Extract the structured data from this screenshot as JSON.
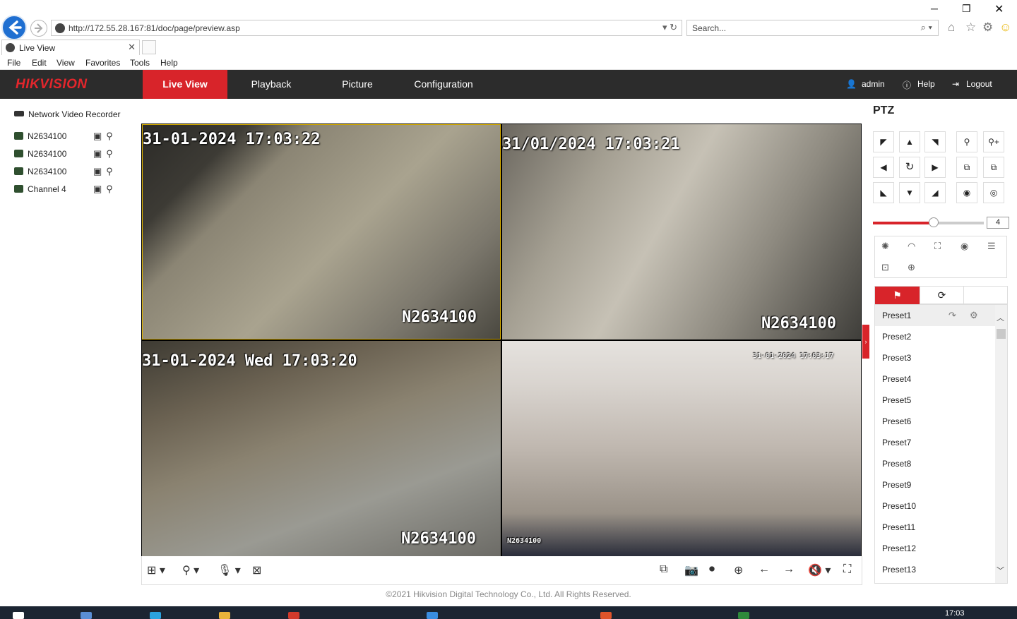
{
  "browser": {
    "url": "http://172.55.28.167:81/doc/page/preview.asp",
    "search_placeholder": "Search...",
    "tab_title": "Live View",
    "menu": [
      "File",
      "Edit",
      "View",
      "Favorites",
      "Tools",
      "Help"
    ]
  },
  "header": {
    "logo": "HIKVISION",
    "nav": [
      "Live View",
      "Playback",
      "Picture",
      "Configuration"
    ],
    "active_nav": "Live View",
    "user": "admin",
    "help": "Help",
    "logout": "Logout"
  },
  "device_tree": {
    "root": "Network Video Recorder",
    "channels": [
      "N2634100",
      "N2634100",
      "N2634100",
      "Channel 4"
    ]
  },
  "video": {
    "cells": [
      {
        "timestamp": "31-01-2024 17:03:22",
        "name": "N2634100"
      },
      {
        "timestamp": "31/01/2024 17:03:21",
        "name": "N2634100"
      },
      {
        "timestamp": "31-01-2024 Wed 17:03:20",
        "name": "N2634100"
      },
      {
        "timestamp": "31-01-2024 17:03:17",
        "name": "N2634100"
      }
    ]
  },
  "ptz": {
    "title": "PTZ",
    "speed": "4",
    "speed_level": 0.55,
    "presets": [
      "Preset1",
      "Preset2",
      "Preset3",
      "Preset4",
      "Preset5",
      "Preset6",
      "Preset7",
      "Preset8",
      "Preset9",
      "Preset10",
      "Preset11",
      "Preset12",
      "Preset13"
    ]
  },
  "footer": "©2021 Hikvision Digital Technology Co., Ltd. All Rights Reserved.",
  "taskbar": {
    "time": "17:03"
  },
  "colors": {
    "accent": "#d8242a",
    "header_bg": "#2c2c2c",
    "selected_border": "#e0b400"
  }
}
